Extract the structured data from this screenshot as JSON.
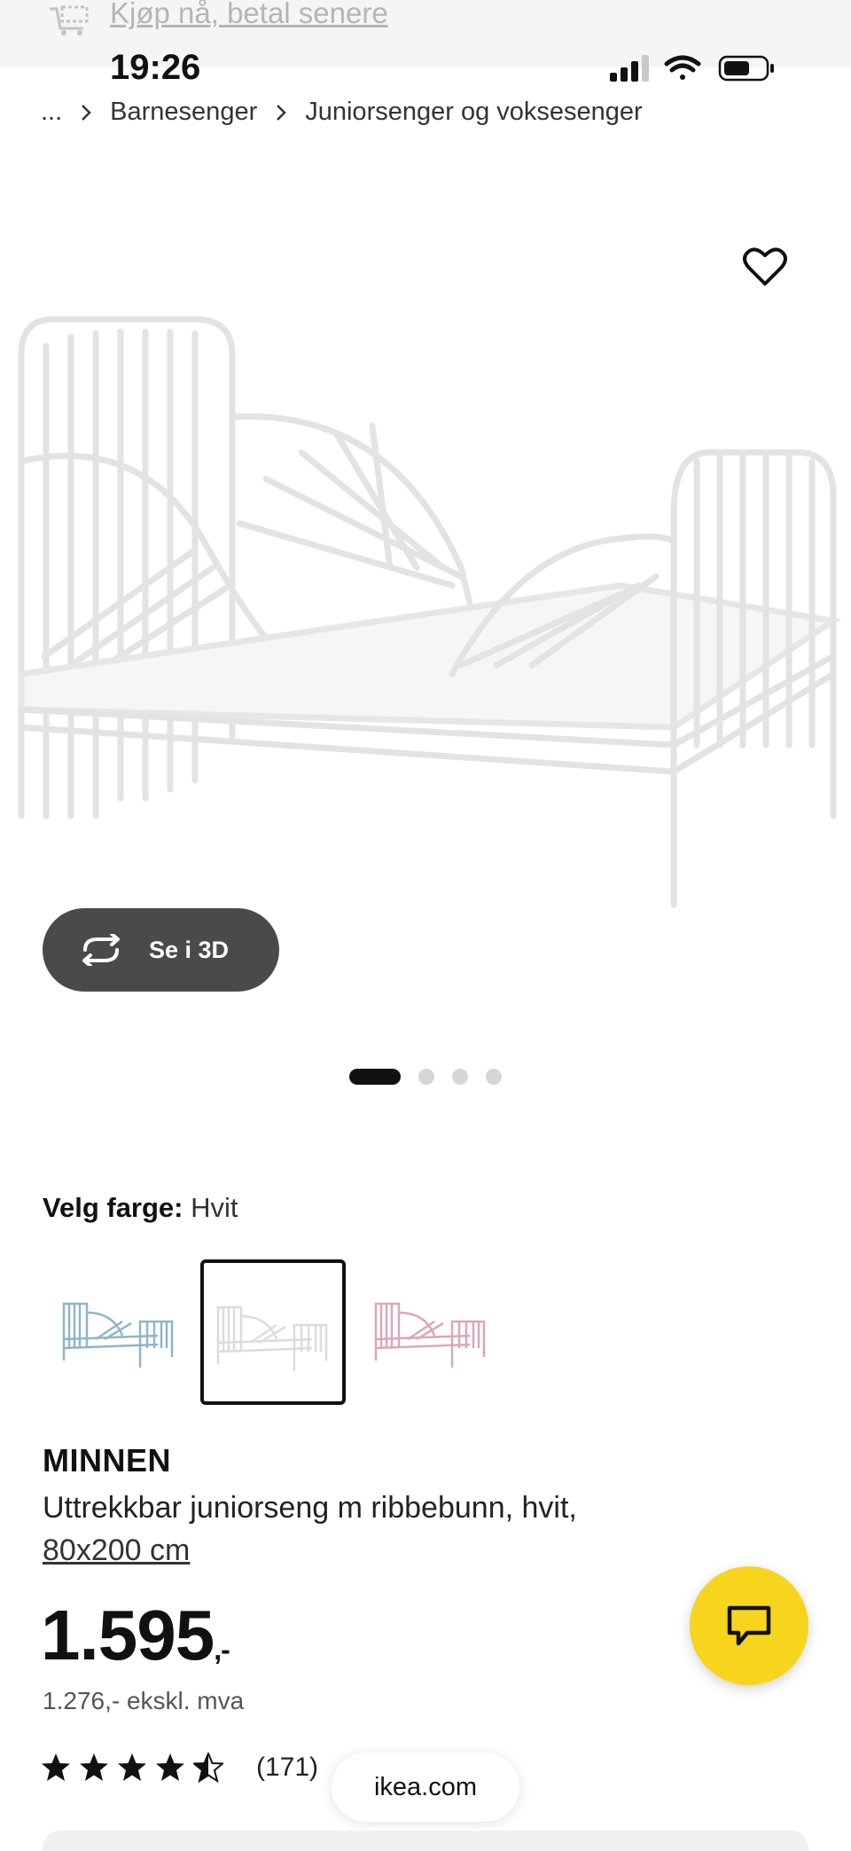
{
  "banner": {
    "text": "Kjøp nå, betal senere",
    "icon": "cart-icon"
  },
  "status_bar": {
    "time": "19:26",
    "icons": [
      "signal-icon",
      "wifi-icon",
      "battery-icon"
    ]
  },
  "breadcrumb": {
    "ellipsis": "...",
    "items": [
      "Barnesenger",
      "Juniorsenger og voksesenger"
    ]
  },
  "gallery": {
    "favorite_icon": "heart-icon",
    "view_3d_label": "Se i 3D",
    "dot_count": 4,
    "active_dot": 0
  },
  "color_picker": {
    "label": "Velg farge:",
    "selected_value": "Hvit",
    "swatches": [
      {
        "color": "#8fb6c6",
        "selected": false
      },
      {
        "color": "#e6e6e6",
        "selected": true
      },
      {
        "color": "#d9a7bd",
        "selected": false
      }
    ]
  },
  "product": {
    "name": "MINNEN",
    "description": "Uttrekkbar juniorseng m ribbebunn, hvit,",
    "size": "80x200 cm",
    "price": "1.595",
    "price_suffix": ",-",
    "price_ex_vat": "1.276,- ekskl. mva",
    "rating": 4.5,
    "review_count": "(171)"
  },
  "browser": {
    "site": "ikea.com"
  },
  "chat": {
    "icon": "chat-icon",
    "color": "#f7d51d"
  }
}
